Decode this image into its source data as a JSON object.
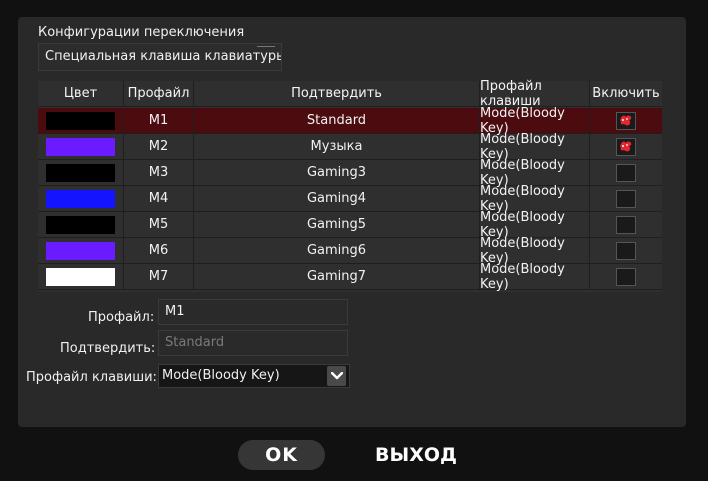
{
  "section_title": "Конфигурации переключения",
  "config_select": {
    "value": "Специальная клавиша клавиатуры"
  },
  "table": {
    "headers": {
      "color": "Цвет",
      "profile": "Профайл",
      "confirm": "Подтвердить",
      "key_profile": "Профайл клавиши",
      "enable": "Включить"
    },
    "rows": [
      {
        "color": "#000000",
        "profile": "M1",
        "confirm": "Standard",
        "key_profile": "Mode(Bloody Key)",
        "enabled": true,
        "selected": true
      },
      {
        "color": "#6a1bff",
        "profile": "M2",
        "confirm": "Музыка",
        "key_profile": "Mode(Bloody Key)",
        "enabled": true,
        "selected": false
      },
      {
        "color": "#000000",
        "profile": "M3",
        "confirm": "Gaming3",
        "key_profile": "Mode(Bloody Key)",
        "enabled": false,
        "selected": false
      },
      {
        "color": "#1414ff",
        "profile": "M4",
        "confirm": "Gaming4",
        "key_profile": "Mode(Bloody Key)",
        "enabled": false,
        "selected": false
      },
      {
        "color": "#000000",
        "profile": "M5",
        "confirm": "Gaming5",
        "key_profile": "Mode(Bloody Key)",
        "enabled": false,
        "selected": false
      },
      {
        "color": "#6a1bff",
        "profile": "M6",
        "confirm": "Gaming6",
        "key_profile": "Mode(Bloody Key)",
        "enabled": false,
        "selected": false
      },
      {
        "color": "#ffffff",
        "profile": "M7",
        "confirm": "Gaming7",
        "key_profile": "Mode(Bloody Key)",
        "enabled": false,
        "selected": false
      }
    ]
  },
  "form": {
    "profile_label": "Профайл:",
    "profile_value": "M1",
    "confirm_label": "Подтвердить:",
    "confirm_placeholder": "Standard",
    "key_profile_label": "Профайл клавиши:",
    "key_profile_value": "Mode(Bloody Key)"
  },
  "buttons": {
    "ok": "OK",
    "exit": "ВЫХОД"
  },
  "colors": {
    "selected_row": "#4c0c0f",
    "panel": "#292929",
    "accent_red": "#e3262f"
  },
  "icons": {
    "enabled": "bloody-hand-icon",
    "dropdown": "chevron-down-icon"
  }
}
